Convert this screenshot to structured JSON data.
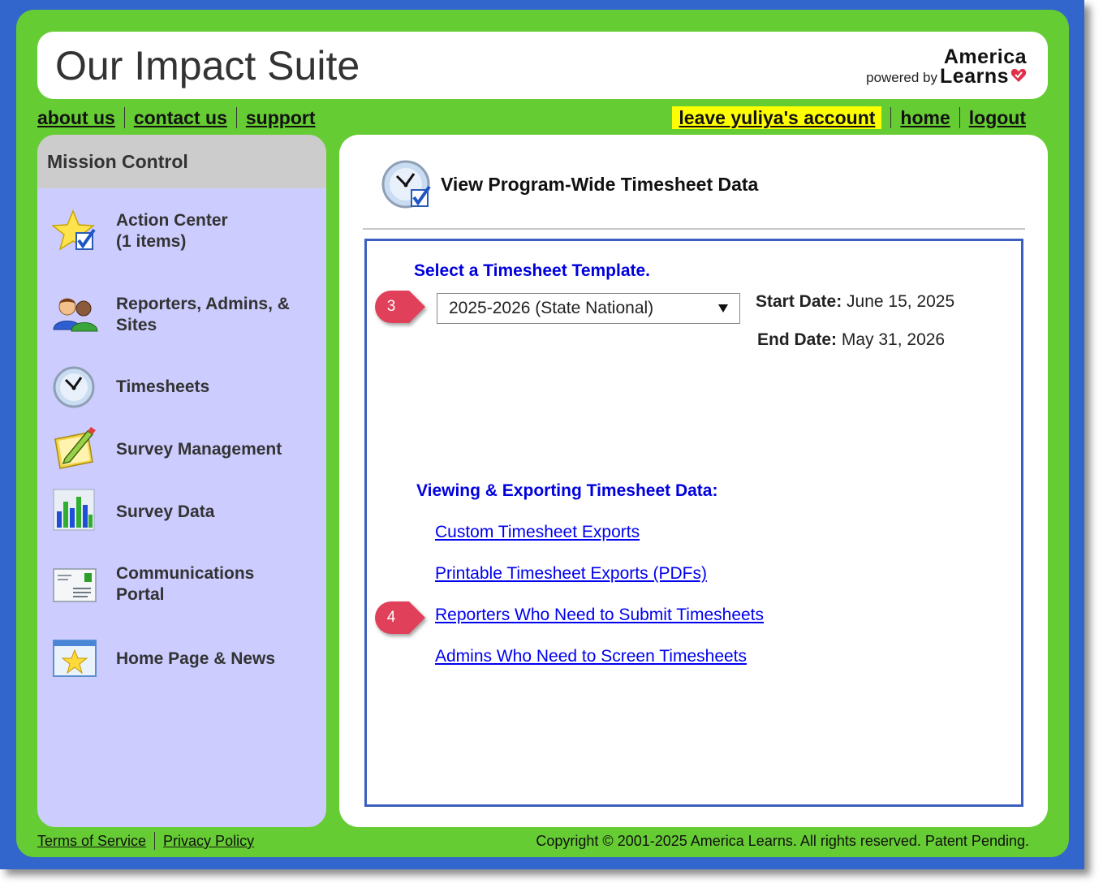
{
  "header": {
    "app_title": "Our Impact Suite",
    "logo": {
      "powered_by": "powered by",
      "brand_top": "America",
      "brand_bottom": "Learns"
    }
  },
  "top_nav": {
    "left": [
      {
        "label": "about us"
      },
      {
        "label": "contact us"
      },
      {
        "label": "support"
      }
    ],
    "right": [
      {
        "label": "leave yuliya's account"
      },
      {
        "label": "home"
      },
      {
        "label": "logout"
      }
    ]
  },
  "sidebar": {
    "title": "Mission Control",
    "items": [
      {
        "line1": "Action Center",
        "line2": "(1 items)",
        "icon": "star-check-icon"
      },
      {
        "line1": "Reporters, Admins, &",
        "line2": "Sites",
        "icon": "users-icon"
      },
      {
        "line1": "Timesheets",
        "line2": "",
        "icon": "clock-icon"
      },
      {
        "line1": "Survey Management",
        "line2": "",
        "icon": "notepad-pencil-icon"
      },
      {
        "line1": "Survey Data",
        "line2": "",
        "icon": "bar-chart-icon"
      },
      {
        "line1": "Communications",
        "line2": "Portal",
        "icon": "envelope-icon"
      },
      {
        "line1": "Home Page & News",
        "line2": "",
        "icon": "window-star-icon"
      }
    ]
  },
  "main": {
    "page_title": "View Program-Wide Timesheet Data",
    "template_heading": "Select a Timesheet Template.",
    "template_select": {
      "selected": "2025-2026 (State National)"
    },
    "start_date_label": "Start Date:",
    "start_date_value": "June 15, 2025",
    "end_date_label": "End Date:",
    "end_date_value": "May 31, 2026",
    "export_heading": "Viewing & Exporting Timesheet Data:",
    "links": [
      {
        "label": "Custom Timesheet Exports"
      },
      {
        "label": "Printable Timesheet Exports (PDFs)"
      },
      {
        "label": "Reporters Who Need to Submit Timesheets"
      },
      {
        "label": "Admins Who Need to Screen Timesheets"
      }
    ],
    "callouts": [
      "3",
      "4"
    ]
  },
  "footer": {
    "links": [
      {
        "label": "Terms of Service"
      },
      {
        "label": "Privacy Policy"
      }
    ],
    "copyright": "Copyright © 2001-2025 America Learns. All rights reserved. Patent Pending."
  },
  "colors": {
    "frame_blue": "#3366cc",
    "app_green": "#66cc33",
    "sidebar_lavender": "#ccccff",
    "heading_blue": "#0000dd",
    "link_blue": "#0000ee",
    "highlight_yellow": "#ffff00",
    "callout_red": "#e0405a"
  }
}
